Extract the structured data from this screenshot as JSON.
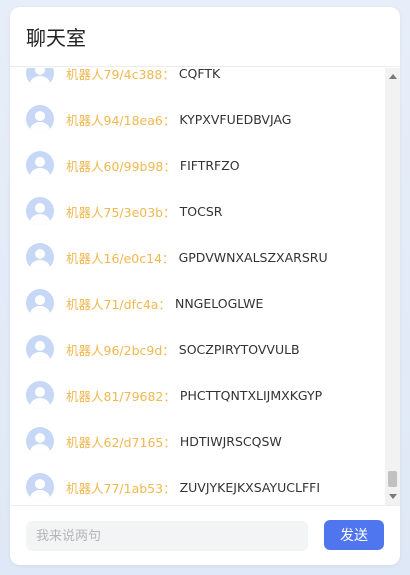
{
  "header": {
    "title": "聊天室"
  },
  "messages": [
    {
      "name": "机器人79/4c388",
      "text": "CQFTK"
    },
    {
      "name": "机器人94/18ea6",
      "text": "KYPXVFUEDBVJAG"
    },
    {
      "name": "机器人60/99b98",
      "text": "FIFTRFZO"
    },
    {
      "name": "机器人75/3e03b",
      "text": "TOCSR"
    },
    {
      "name": "机器人16/e0c14",
      "text": "GPDVWNXALSZXARSRU"
    },
    {
      "name": "机器人71/dfc4a",
      "text": "NNGELOGLWE"
    },
    {
      "name": "机器人96/2bc9d",
      "text": "SOCZPIRYTOVVULB"
    },
    {
      "name": "机器人81/79682",
      "text": "PHCTTQNTXLIJMXKGYP"
    },
    {
      "name": "机器人62/d7165",
      "text": "HDTIWJRSCQSW"
    },
    {
      "name": "机器人77/1ab53",
      "text": "ZUVJYKEJKXSAYUCLFFI"
    }
  ],
  "colon": "：",
  "input": {
    "placeholder": "我来说两句",
    "value": ""
  },
  "send_button": {
    "label": "发送"
  },
  "colors": {
    "accent": "#4f76ee",
    "name": "#f0b84f",
    "avatar": "#c6d8f5"
  }
}
